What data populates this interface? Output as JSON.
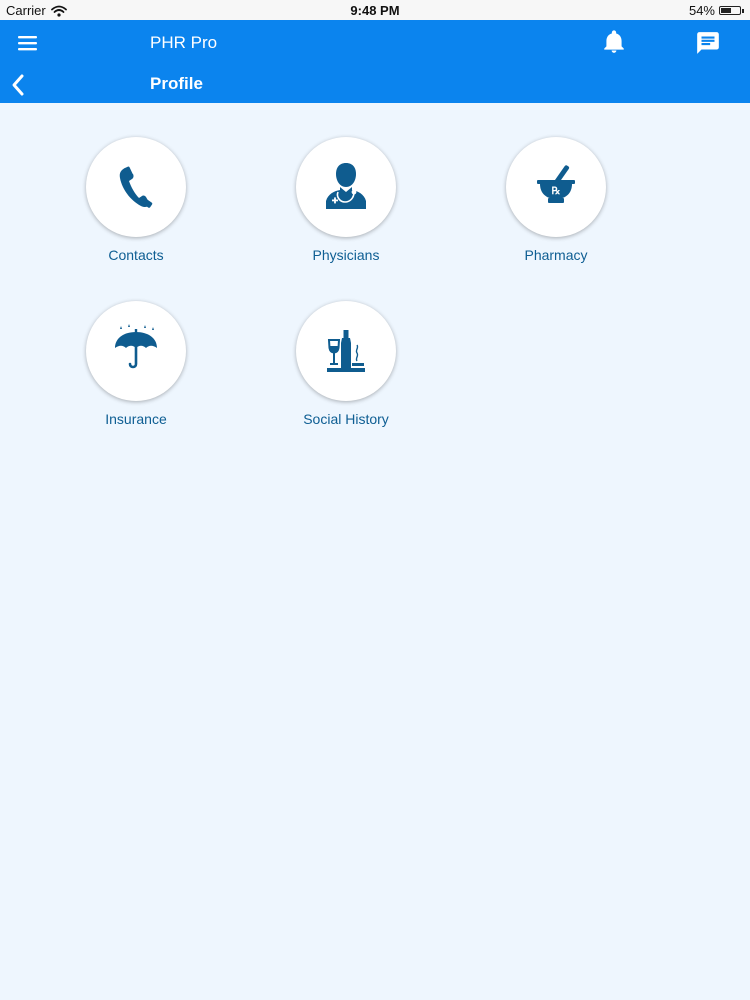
{
  "status_bar": {
    "carrier": "Carrier",
    "time": "9:48 PM",
    "battery": "54%",
    "battery_level": 0.54
  },
  "header": {
    "app_title": "PHR Pro",
    "page_title": "Profile",
    "icons": {
      "menu": "menu-icon",
      "notifications": "bell-icon",
      "messages": "chat-icon",
      "back": "chevron-left-icon"
    },
    "background_color": "#0b84ee"
  },
  "tiles": [
    {
      "label": "Contacts",
      "icon": "phone-icon"
    },
    {
      "label": "Physicians",
      "icon": "doctor-icon"
    },
    {
      "label": "Pharmacy",
      "icon": "mortar-pestle-icon"
    },
    {
      "label": "Insurance",
      "icon": "umbrella-icon"
    },
    {
      "label": "Social History",
      "icon": "wine-bottle-icon"
    }
  ],
  "colors": {
    "icon": "#0f5c8f",
    "label": "#0e5e93",
    "page_background": "#eef6fe"
  }
}
